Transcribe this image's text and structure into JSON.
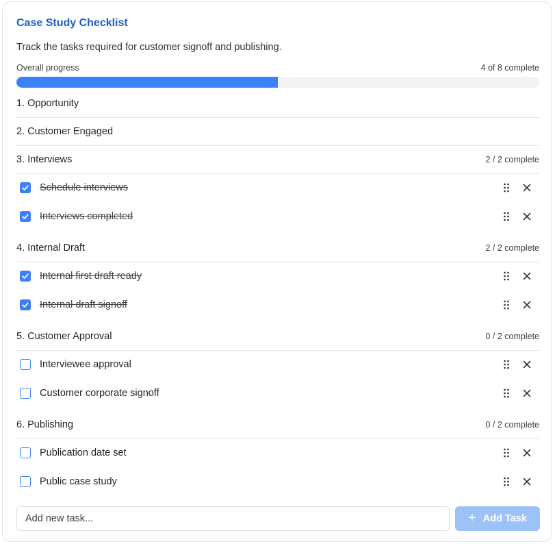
{
  "header": {
    "title": "Case Study Checklist",
    "subtitle": "Track the tasks required for customer signoff and publishing."
  },
  "progress": {
    "label": "Overall progress",
    "count_text": "4 of 8 complete",
    "completed": 4,
    "total": 8
  },
  "sections": [
    {
      "title": "1. Opportunity",
      "count": "",
      "tasks": []
    },
    {
      "title": "2. Customer Engaged",
      "count": "",
      "tasks": []
    },
    {
      "title": "3. Interviews",
      "count": "2 / 2 complete",
      "tasks": [
        {
          "label": "Schedule interviews",
          "done": true
        },
        {
          "label": "Interviews completed",
          "done": true
        }
      ]
    },
    {
      "title": "4. Internal Draft",
      "count": "2 / 2 complete",
      "tasks": [
        {
          "label": "Internal first draft ready",
          "done": true
        },
        {
          "label": "Internal draft signoff",
          "done": true
        }
      ]
    },
    {
      "title": "5. Customer Approval",
      "count": "0 / 2 complete",
      "tasks": [
        {
          "label": "Interviewee approval",
          "done": false
        },
        {
          "label": "Customer corporate signoff",
          "done": false
        }
      ]
    },
    {
      "title": "6. Publishing",
      "count": "0 / 2 complete",
      "tasks": [
        {
          "label": "Publication date set",
          "done": false
        },
        {
          "label": "Public case study",
          "done": false
        }
      ]
    }
  ],
  "add_task": {
    "placeholder": "Add new task...",
    "button_label": "Add Task",
    "button_icon": "plus-icon"
  },
  "colors": {
    "accent": "#3b82f6",
    "title": "#1b5fc4",
    "button_disabled": "#9dc2f8"
  }
}
